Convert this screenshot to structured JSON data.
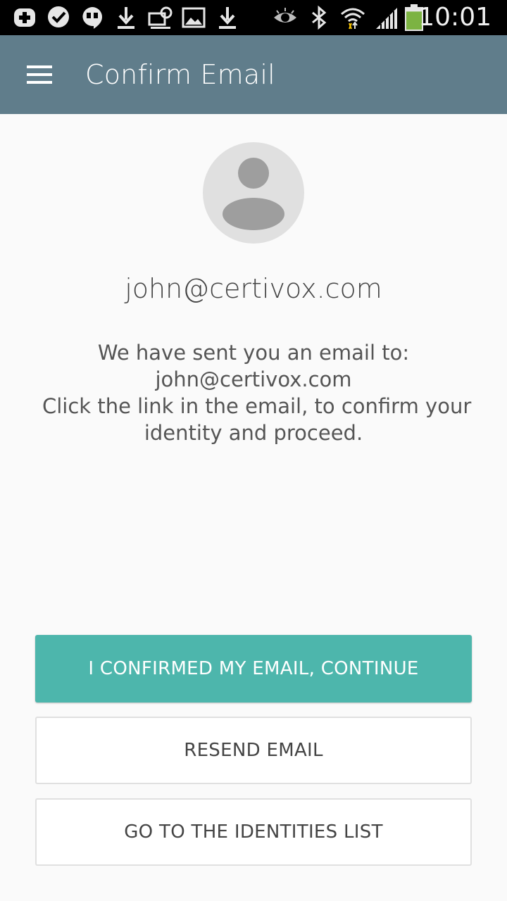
{
  "status_bar": {
    "time": "10:01",
    "icons": [
      "plus-shield-icon",
      "check-heart-icon",
      "hangouts-icon",
      "download-icon",
      "voicemail-icon",
      "image-icon",
      "download-icon",
      "eye-icon",
      "bluetooth-icon",
      "wifi-icon",
      "signal-icon",
      "battery-icon"
    ],
    "battery_level": 0.8
  },
  "app_bar": {
    "title": "Confirm Email",
    "menu_icon": "hamburger-menu-icon",
    "color": "#607d8b"
  },
  "profile": {
    "avatar_icon": "person-avatar-icon",
    "email": "john@certivox.com"
  },
  "message": {
    "line1": "We have sent you an email to:",
    "line2": "john@certivox.com",
    "line3": "Click the link in the email, to confirm your",
    "line4": "identity and proceed."
  },
  "buttons": {
    "confirm": "I CONFIRMED MY EMAIL, CONTINUE",
    "resend": "RESEND EMAIL",
    "identities": "GO TO THE IDENTITIES LIST"
  },
  "colors": {
    "accent": "#4db6ac",
    "app_bar": "#607d8b",
    "battery": "#7cb342"
  }
}
